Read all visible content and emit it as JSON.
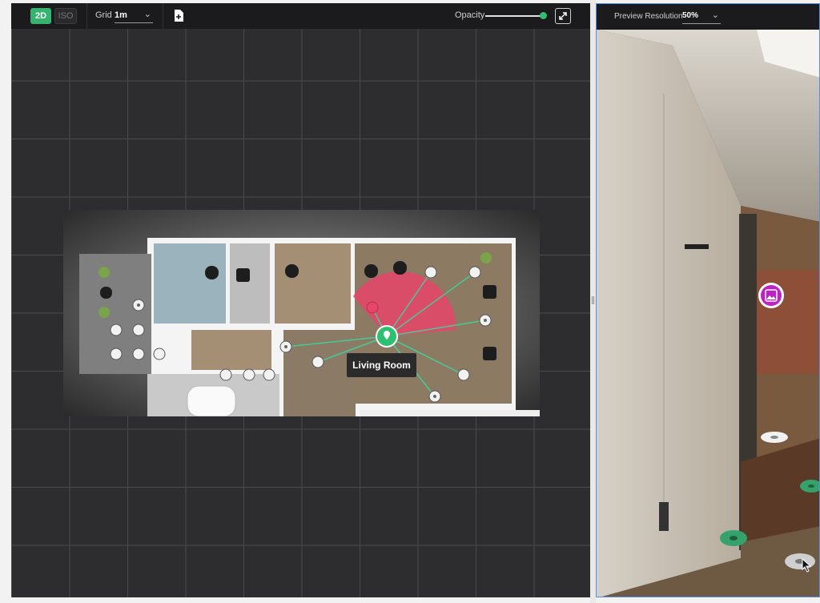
{
  "toolbar": {
    "view_2d": "2D",
    "view_iso": "ISO",
    "grid_label": "Grid",
    "grid_value": "1m",
    "opacity_label": "Opacity",
    "opacity_value": 0.95,
    "icons": [
      "chevron-down-icon",
      "document-add-icon",
      "expand-icon"
    ]
  },
  "floorplan": {
    "room_label": "Living Room",
    "accent_color": "#2fbf71",
    "view_cone_color": "#e8456a"
  },
  "preview": {
    "resolution_label": "Preview Resolution",
    "resolution_value": "50%",
    "hotspot_color": "#c020c8"
  }
}
